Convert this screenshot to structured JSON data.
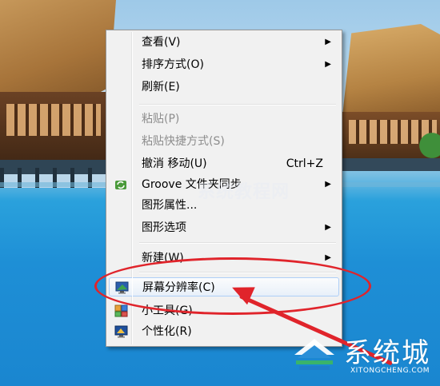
{
  "menu": {
    "items": [
      {
        "label": "查看(V)",
        "submenu": true,
        "disabled": false
      },
      {
        "label": "排序方式(O)",
        "submenu": true,
        "disabled": false
      },
      {
        "label": "刷新(E)",
        "submenu": false,
        "disabled": false
      },
      {
        "label": "粘贴(P)",
        "submenu": false,
        "disabled": true
      },
      {
        "label": "粘贴快捷方式(S)",
        "submenu": false,
        "disabled": true
      },
      {
        "label": "撤消 移动(U)",
        "shortcut": "Ctrl+Z",
        "submenu": false,
        "disabled": false
      },
      {
        "label": "Groove 文件夹同步",
        "submenu": true,
        "disabled": false,
        "icon": "groove-sync-icon"
      },
      {
        "label": "图形属性...",
        "submenu": false,
        "disabled": false
      },
      {
        "label": "图形选项",
        "submenu": true,
        "disabled": false
      },
      {
        "label": "新建(W)",
        "submenu": true,
        "disabled": false
      },
      {
        "label": "屏幕分辨率(C)",
        "submenu": false,
        "disabled": false,
        "icon": "screen-resolution-icon",
        "highlighted": true
      },
      {
        "label": "小工具(G)",
        "submenu": false,
        "disabled": false,
        "icon": "gadgets-icon"
      },
      {
        "label": "个性化(R)",
        "submenu": false,
        "disabled": false,
        "icon": "personalize-icon"
      }
    ],
    "arrow_glyph": "▶"
  },
  "annotation": {
    "color": "#e0242b"
  },
  "watermark": {
    "center_text": "系统教程网",
    "title": "系统城",
    "subtitle": "XITONGCHENG.COM"
  }
}
